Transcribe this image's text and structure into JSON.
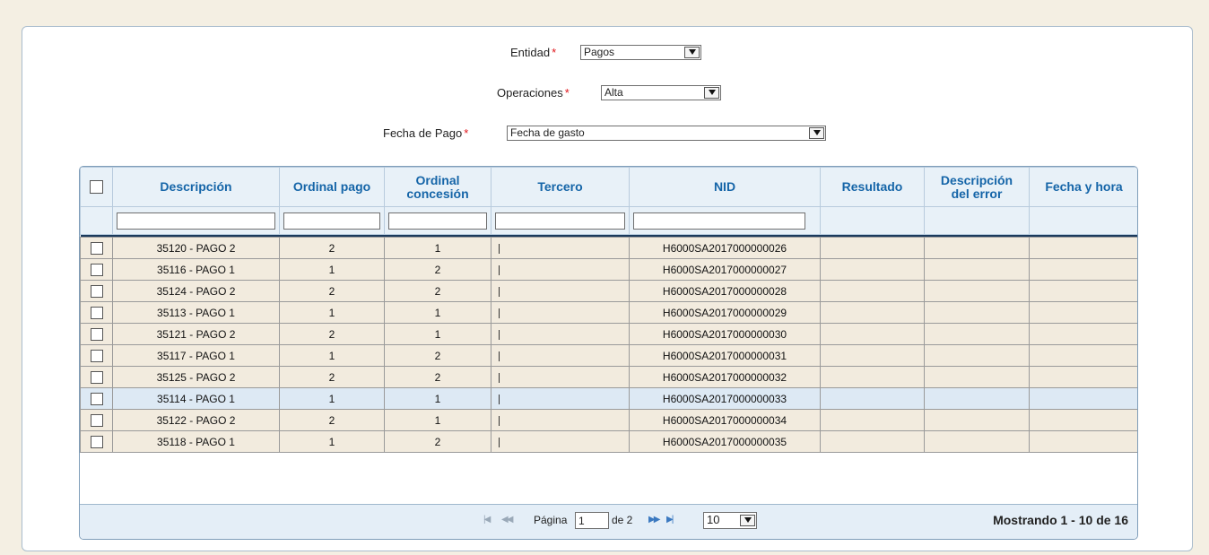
{
  "form": {
    "entidad_label": "Entidad",
    "entidad_value": "Pagos",
    "operaciones_label": "Operaciones",
    "operaciones_value": "Alta",
    "fecha_label": "Fecha de Pago",
    "fecha_value": "Fecha de gasto",
    "required_mark": "*"
  },
  "table": {
    "columns": [
      "Descripción",
      "Ordinal pago",
      "Ordinal concesión",
      "Tercero",
      "NID",
      "Resultado",
      "Descripción del error",
      "Fecha y hora"
    ],
    "rows": [
      {
        "descripcion": "35120 - PAGO 2",
        "ordinal_pago": "2",
        "ordinal_concesion": "1",
        "nid": "H6000SA2017000000026"
      },
      {
        "descripcion": "35116 - PAGO 1",
        "ordinal_pago": "1",
        "ordinal_concesion": "2",
        "nid": "H6000SA2017000000027"
      },
      {
        "descripcion": "35124 - PAGO 2",
        "ordinal_pago": "2",
        "ordinal_concesion": "2",
        "nid": "H6000SA2017000000028"
      },
      {
        "descripcion": "35113 - PAGO 1",
        "ordinal_pago": "1",
        "ordinal_concesion": "1",
        "nid": "H6000SA2017000000029"
      },
      {
        "descripcion": "35121 - PAGO 2",
        "ordinal_pago": "2",
        "ordinal_concesion": "1",
        "nid": "H6000SA2017000000030"
      },
      {
        "descripcion": "35117 - PAGO 1",
        "ordinal_pago": "1",
        "ordinal_concesion": "2",
        "nid": "H6000SA2017000000031"
      },
      {
        "descripcion": "35125 - PAGO 2",
        "ordinal_pago": "2",
        "ordinal_concesion": "2",
        "nid": "H6000SA2017000000032"
      },
      {
        "descripcion": "35114 - PAGO 1",
        "ordinal_pago": "1",
        "ordinal_concesion": "1",
        "nid": "H6000SA2017000000033",
        "selected": true
      },
      {
        "descripcion": "35122 - PAGO 2",
        "ordinal_pago": "2",
        "ordinal_concesion": "1",
        "nid": "H6000SA2017000000034"
      },
      {
        "descripcion": "35118 - PAGO 1",
        "ordinal_pago": "1",
        "ordinal_concesion": "2",
        "nid": "H6000SA2017000000035"
      }
    ]
  },
  "pager": {
    "page_label": "Página",
    "page_value": "1",
    "of_label": "de 2",
    "page_size": "10",
    "summary": "Mostrando 1 - 10 de 16"
  },
  "colors": {
    "header_text": "#1565a8",
    "row_bg": "#f2ebde",
    "selected_row_bg": "#dde9f4",
    "required": "#e0141a"
  }
}
